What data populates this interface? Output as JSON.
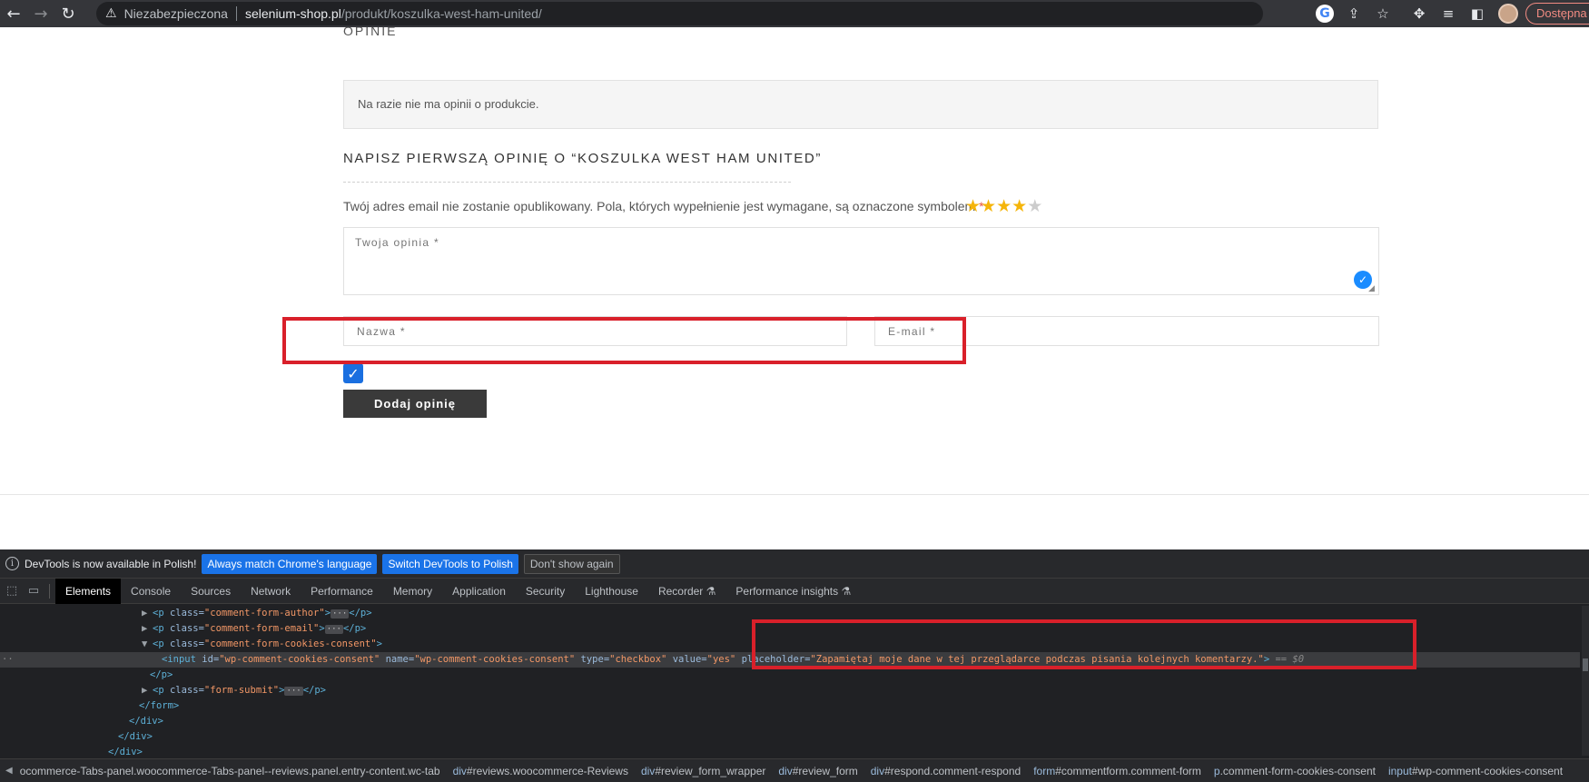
{
  "browser": {
    "security_label": "Niezabezpieczona",
    "url_host": "selenium-shop.pl",
    "url_path": "/produkt/koszulka-west-ham-united/",
    "update_button": "Dostępna je"
  },
  "page": {
    "reviews_heading": "OPINIE",
    "no_reviews": "Na razie nie ma opinii o produkcie.",
    "form_title": "NAPISZ PIERWSZĄ OPINIĘ O “KOSZULKA WEST HAM UNITED”",
    "notes_text": "Twój adres email nie zostanie opublikowany. Pola, których wypełnienie jest wymagane, są oznaczone symbolem ",
    "notes_required": "*",
    "rating": {
      "value": 4,
      "max": 5,
      "filled_color": "#f5b50a",
      "empty_color": "#cccccc"
    },
    "comment_placeholder": "Twoja opinia *",
    "name_placeholder": "Nazwa *",
    "email_placeholder": "E-mail *",
    "consent_checked": true,
    "submit_label": "Dodaj opinię"
  },
  "devtools": {
    "info_text": "DevTools is now available in Polish!",
    "info_btn_1": "Always match Chrome's language",
    "info_btn_2": "Switch DevTools to Polish",
    "info_btn_3": "Don't show again",
    "tabs": [
      "Elements",
      "Console",
      "Sources",
      "Network",
      "Performance",
      "Memory",
      "Application",
      "Security",
      "Lighthouse",
      "Recorder ⚗",
      "Performance insights ⚗"
    ],
    "active_tab": "Elements",
    "code": {
      "l1_tag": "<p",
      "l1_attr": "class=",
      "l1_val": "\"comment-form-author\"",
      "l1_end": "</p>",
      "l2_val": "\"comment-form-email\"",
      "l3_val": "\"comment-form-cookies-consent\"",
      "l4_tag": "<input",
      "l4_id": "\"wp-comment-cookies-consent\"",
      "l4_name": "\"wp-comment-cookies-consent\"",
      "l4_type": "\"checkbox\"",
      "l4_value": "\"yes\"",
      "l4_placeholder": "\"Zapamiętaj moje dane w tej przeglądarce podczas pisania kolejnych komentarzy.\"",
      "l4_suffix": "== $0",
      "l5": "</p>",
      "l6_val": "\"form-submit\"",
      "l7": "</form>",
      "l8": "</div>",
      "l9": "</div>",
      "l10": "</div>"
    },
    "breadcrumbs": [
      {
        "tag": "",
        "rest": "ocommerce-Tabs-panel.woocommerce-Tabs-panel--reviews.panel.entry-content.wc-tab"
      },
      {
        "tag": "div",
        "rest": "#reviews.woocommerce-Reviews"
      },
      {
        "tag": "div",
        "rest": "#review_form_wrapper"
      },
      {
        "tag": "div",
        "rest": "#review_form"
      },
      {
        "tag": "div",
        "rest": "#respond.comment-respond"
      },
      {
        "tag": "form",
        "rest": "#commentform.comment-form"
      },
      {
        "tag": "p",
        "rest": ".comment-form-cookies-consent"
      },
      {
        "tag": "input",
        "rest": "#wp-comment-cookies-consent"
      }
    ]
  }
}
